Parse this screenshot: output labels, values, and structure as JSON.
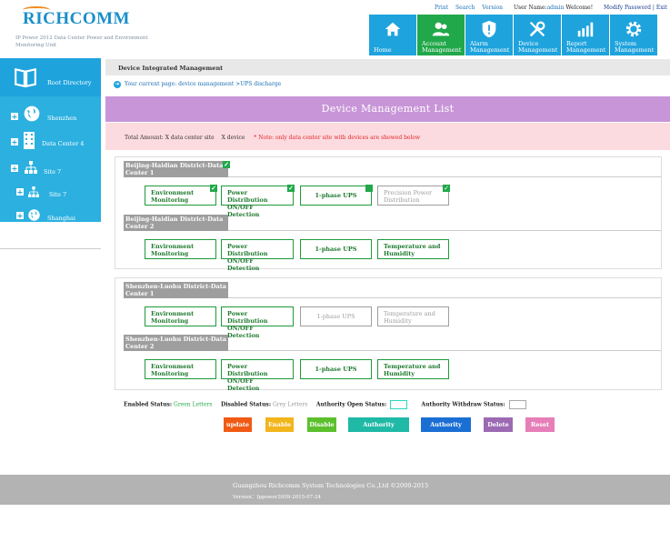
{
  "header": {
    "logo": "RICHCOMM",
    "tagline": "IP Power 2012 Data Center Power and Environment Monitoring Unit",
    "links": [
      "Print",
      "Search",
      "Version"
    ],
    "user_prefix": "User Name:",
    "user_name": "admin",
    "welcome": "Welcome!",
    "modify": "Modify Password",
    "sep": "|",
    "exit": "Exit"
  },
  "nav": [
    {
      "label": "Home",
      "icon": "home-icon"
    },
    {
      "label": "Account Management",
      "icon": "users-icon"
    },
    {
      "label": "Alarm Management",
      "icon": "shield-alarm-icon"
    },
    {
      "label": "Device Management",
      "icon": "tools-icon"
    },
    {
      "label": "Report Management",
      "icon": "chart-icon"
    },
    {
      "label": "System Management",
      "icon": "gear-icon"
    }
  ],
  "sidebar": {
    "root": "Root Directory",
    "items": [
      {
        "label": "Shenzhen",
        "icon": "globe-icon"
      },
      {
        "label": "Data Center 4",
        "icon": "building-icon"
      },
      {
        "label": "Site 7",
        "icon": "network-icon"
      },
      {
        "label": "Site 7",
        "icon": "network-icon"
      },
      {
        "label": "Shanghai",
        "icon": "globe-icon"
      }
    ]
  },
  "main": {
    "title": "Device Integrated Management",
    "crumb": "Your current page: device management >UPS discharge",
    "list_title": "Device Management List",
    "total_label": "Total Amount:",
    "total_sites": "X data center site",
    "total_devices": "X device",
    "note": "* Note: only data center site with devices are showed below"
  },
  "groups": [
    {
      "sites": [
        {
          "name": "Beijing-Haidian District-Data Center 1",
          "devices": [
            {
              "label": "Environment Monitoring",
              "enabled": true,
              "checked": true
            },
            {
              "label": "Power Distribution ON/OFF Detection",
              "enabled": true,
              "checked": true
            },
            {
              "label": "1-phase UPS",
              "enabled": true,
              "checked": true
            },
            {
              "label": "Precision Power Distribution",
              "enabled": false,
              "checked": true
            }
          ]
        },
        {
          "name": "Beijing-Haidian District-Data Center 2",
          "devices": [
            {
              "label": "Environment Monitoring",
              "enabled": true,
              "checked": false
            },
            {
              "label": "Power Distribution ON/OFF Detection",
              "enabled": true,
              "checked": false
            },
            {
              "label": "1-phase UPS",
              "enabled": true,
              "checked": false
            },
            {
              "label": "Temperature and Humidity",
              "enabled": true,
              "checked": false
            }
          ]
        }
      ]
    },
    {
      "sites": [
        {
          "name": "Shenzhen-Luohu District-Data Center 1",
          "devices": [
            {
              "label": "Environment Monitoring",
              "enabled": true,
              "checked": false
            },
            {
              "label": "Power Distribution ON/OFF Detection",
              "enabled": true,
              "checked": false
            },
            {
              "label": "1-phase UPS",
              "enabled": false,
              "checked": false
            },
            {
              "label": "Temperature and Humidity",
              "enabled": false,
              "checked": false
            }
          ]
        },
        {
          "name": "Shenzhen-Luohu District-Data Center 2",
          "devices": [
            {
              "label": "Environment Monitoring",
              "enabled": true,
              "checked": false
            },
            {
              "label": "Power Distribution ON/OFF Detection",
              "enabled": true,
              "checked": false
            },
            {
              "label": "1-phase UPS",
              "enabled": true,
              "checked": false
            },
            {
              "label": "Temperature and Humidity",
              "enabled": true,
              "checked": false
            }
          ]
        }
      ]
    }
  ],
  "status": {
    "enabled_label": "Enabled Status:",
    "enabled_value": "Green Letters",
    "disabled_label": "Disabled Status:",
    "disabled_value": "Grey Letters",
    "open_label": "Authority Open Status:",
    "open_color": "#2bd7c0",
    "withdraw_label": "Authority Withdraw Status:",
    "withdraw_color": "#a9a9a9"
  },
  "actions": [
    {
      "label": "update",
      "color": "#f05a14"
    },
    {
      "label": "Enable",
      "color": "#f2b51c"
    },
    {
      "label": "Disable",
      "color": "#5cc02e"
    },
    {
      "label": "Authority Withdraw",
      "color": "#1fb9a6"
    },
    {
      "label": "Authority Open",
      "color": "#1b6fd4"
    },
    {
      "label": "Delete",
      "color": "#9c6ab2"
    },
    {
      "label": "Reset",
      "color": "#e67fb7"
    }
  ],
  "footer": {
    "company": "Guangzhou Richcomm System Technologies Co.,Ltd ©2000-2015",
    "version": "Version：Ippower2009-2015-07-24"
  }
}
